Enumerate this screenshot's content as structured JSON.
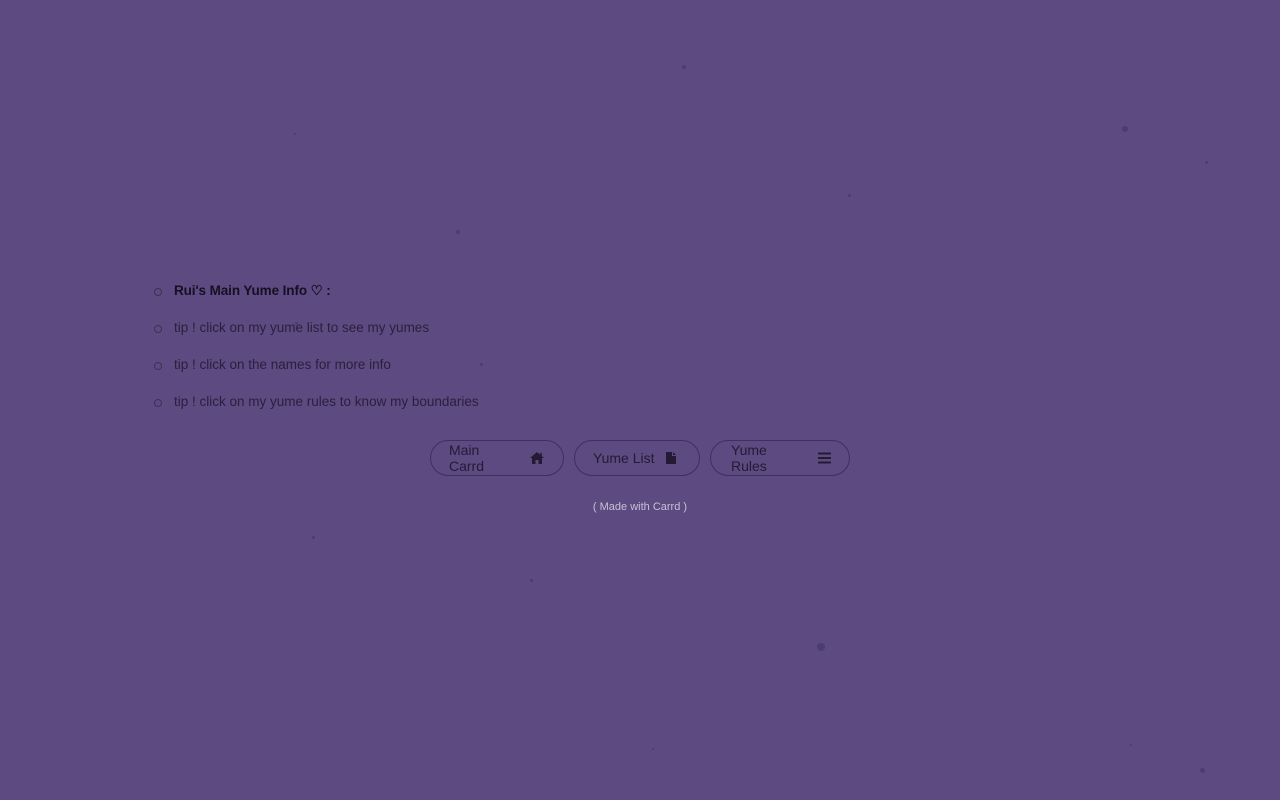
{
  "info": {
    "title": "Rui's Main Yume Info ♡ :",
    "tips": [
      "tip ! click on my yume list to see my yumes",
      "tip ! click on the names for more info",
      "tip ! click on my yume rules to know my boundaries"
    ]
  },
  "nav": {
    "buttons": [
      {
        "label": "Main Carrd",
        "icon": "home-icon"
      },
      {
        "label": "Yume List",
        "icon": "document-icon"
      },
      {
        "label": "Yume Rules",
        "icon": "menu-icon"
      }
    ]
  },
  "footer": {
    "credit": "( Made with Carrd )"
  },
  "colors": {
    "background": "#5d4a80",
    "text": "#241a35",
    "footer_text": "#c8bfd9"
  }
}
